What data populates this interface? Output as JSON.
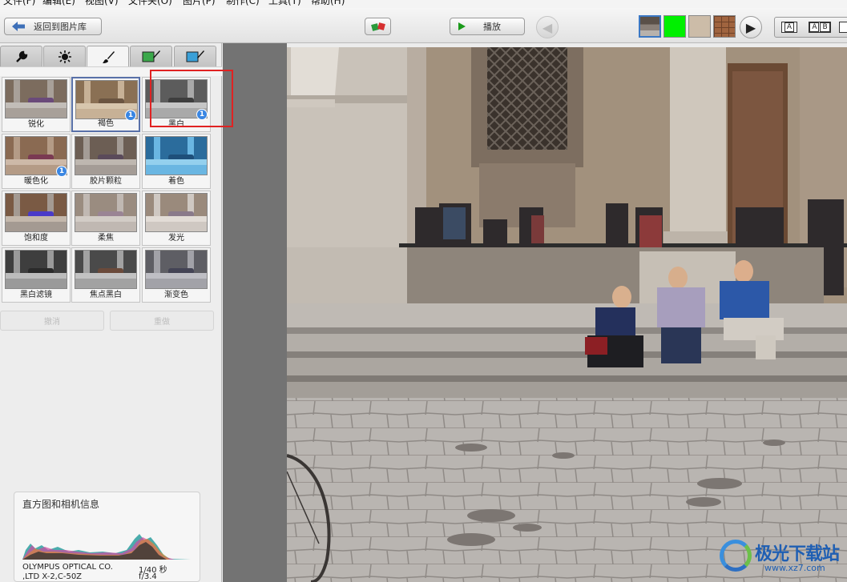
{
  "menu": [
    "文件(F)",
    "编辑(E)",
    "视图(V)",
    "文件夹(O)",
    "图片(P)",
    "制作(C)",
    "工具(T)",
    "帮助(H)"
  ],
  "toolbar": {
    "back_label": "返回到图片库",
    "play_label": "播放",
    "layout_single": "A",
    "layout_double": [
      "A",
      "B"
    ]
  },
  "tabs": [
    {
      "icon": "wrench-icon",
      "glyph": "🔧"
    },
    {
      "icon": "sun-icon",
      "glyph": "✲"
    },
    {
      "icon": "brush-icon",
      "glyph": "🖌"
    },
    {
      "icon": "green-brush-icon",
      "glyph": "▰"
    },
    {
      "icon": "blue-brush-icon",
      "glyph": "▰"
    }
  ],
  "effects": [
    {
      "label": "锐化",
      "tone": "normal",
      "badge": ""
    },
    {
      "label": "褐色",
      "tone": "sepia",
      "badge": "1",
      "selected": true
    },
    {
      "label": "黑白",
      "tone": "bw",
      "badge": "1"
    },
    {
      "label": "暖色化",
      "tone": "warm",
      "badge": "1"
    },
    {
      "label": "胶片颗粒",
      "tone": "grain",
      "badge": ""
    },
    {
      "label": "着色",
      "tone": "blue",
      "badge": ""
    },
    {
      "label": "饱和度",
      "tone": "saturated",
      "badge": ""
    },
    {
      "label": "柔焦",
      "tone": "soft",
      "badge": ""
    },
    {
      "label": "发光",
      "tone": "glow",
      "badge": ""
    },
    {
      "label": "黑白滤镜",
      "tone": "bwfilter",
      "badge": ""
    },
    {
      "label": "焦点黑白",
      "tone": "focusbw",
      "badge": ""
    },
    {
      "label": "渐变色",
      "tone": "gradient",
      "badge": ""
    }
  ],
  "edit": {
    "undo_label": "撤消",
    "redo_label": "重做"
  },
  "histogram": {
    "title": "直方图和相机信息",
    "camera_make": "OLYMPUS OPTICAL CO.",
    "camera_model": ",LTD X-2,C-50Z",
    "shutter": "1/40 秒",
    "aperture": "f/3.4"
  },
  "watermark": {
    "brand": "极光下载站",
    "url": "www.xz7.com"
  },
  "colors": {
    "accent": "#3a86e2",
    "highlight": "#e02222",
    "selected_border": "#5870a8"
  }
}
